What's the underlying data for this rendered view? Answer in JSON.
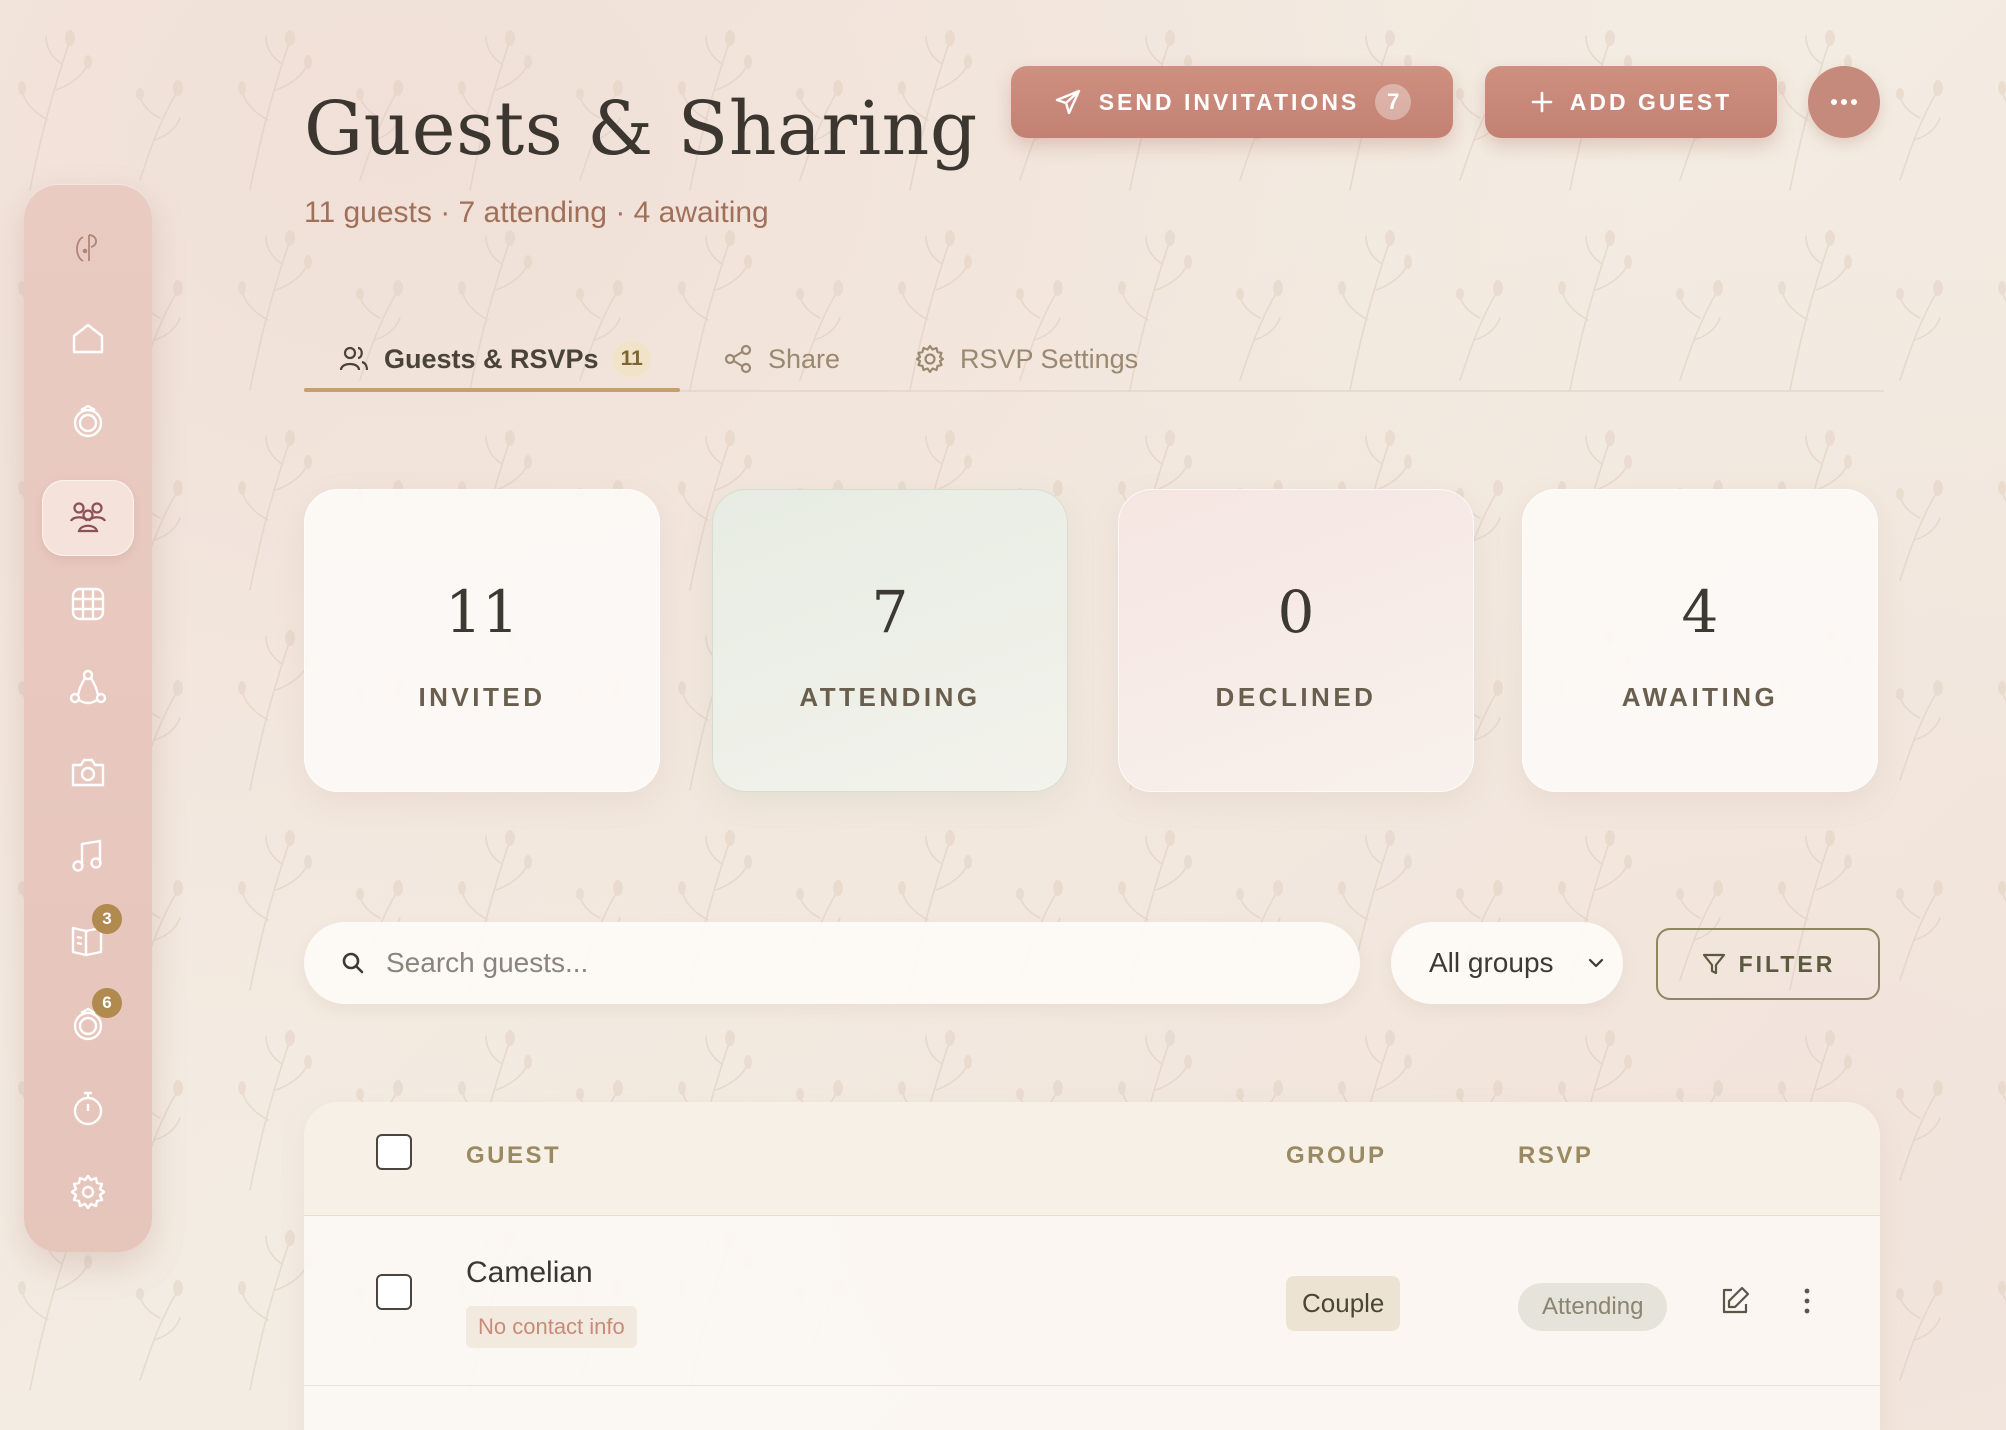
{
  "header": {
    "title": "Guests & Sharing",
    "subtitle": "11 guests · 7 attending · 4 awaiting",
    "send_label": "SEND INVITATIONS",
    "send_count": "7",
    "add_label": "ADD GUEST"
  },
  "sidebar": {
    "items": [
      {
        "icon": "monogram-logo-icon",
        "active": false
      },
      {
        "icon": "home-icon",
        "active": false
      },
      {
        "icon": "rings-icon",
        "active": false
      },
      {
        "icon": "guests-icon",
        "active": true
      },
      {
        "icon": "seating-grid-icon",
        "active": false
      },
      {
        "icon": "network-icon",
        "active": false
      },
      {
        "icon": "camera-icon",
        "active": false
      },
      {
        "icon": "music-icon",
        "active": false
      },
      {
        "icon": "book-icon",
        "active": false,
        "badge": "3"
      },
      {
        "icon": "gift-icon",
        "active": false,
        "badge": "6"
      },
      {
        "icon": "timer-icon",
        "active": false
      },
      {
        "icon": "settings-icon",
        "active": false
      }
    ]
  },
  "tabs": [
    {
      "label": "Guests & RSVPs",
      "count": "11",
      "icon": "users-icon",
      "active": true
    },
    {
      "label": "Share",
      "icon": "share-icon",
      "active": false
    },
    {
      "label": "RSVP Settings",
      "icon": "gear-icon",
      "active": false
    }
  ],
  "stats": [
    {
      "value": "11",
      "label": "INVITED"
    },
    {
      "value": "7",
      "label": "ATTENDING"
    },
    {
      "value": "0",
      "label": "DECLINED"
    },
    {
      "value": "4",
      "label": "AWAITING"
    }
  ],
  "search": {
    "placeholder": "Search guests..."
  },
  "group_select": {
    "selected": "All groups"
  },
  "filter_label": "FILTER",
  "table": {
    "columns": [
      "GUEST",
      "GROUP",
      "RSVP"
    ],
    "rows": [
      {
        "name": "Camelian",
        "contact": "No contact info",
        "group": "Couple",
        "rsvp": "Attending"
      }
    ]
  },
  "colors": {
    "accent": "#c58a7b",
    "gold": "#c6a06b",
    "olive": "#8c8860",
    "sidebar": "#e8c8bf"
  }
}
